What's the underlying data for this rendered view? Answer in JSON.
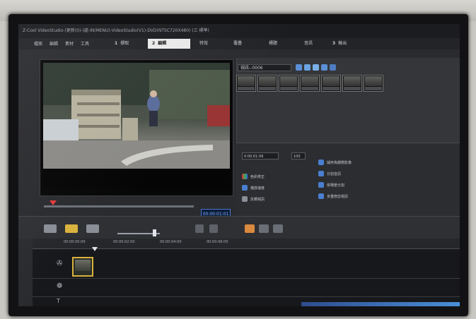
{
  "window": {
    "title": "Z-Cool VideoStudio-(更新(0)-)處-IN(MENU)-VideoStudio(V1)-DVD(NTSC720X480) (三 標準)"
  },
  "menu": {
    "items": [
      "檔案",
      "編輯",
      "素材",
      "工具"
    ]
  },
  "steps": [
    {
      "num": "1",
      "label": "擷取"
    },
    {
      "num": "2",
      "label": "編輯"
    },
    {
      "num": "",
      "label": "特效"
    },
    {
      "num": "",
      "label": "覆疊"
    },
    {
      "num": "",
      "label": "標題"
    },
    {
      "num": "",
      "label": "音訊"
    },
    {
      "num": "3",
      "label": "輸出"
    }
  ],
  "player": {
    "timecode": "00:00:01:01"
  },
  "library": {
    "dropdown": "視訊--0006",
    "thumb_count": 7
  },
  "options": {
    "duration_value": "0:00:01:09",
    "volume_value": "100",
    "items": [
      {
        "label": "色彩修正",
        "icon": "palette-icon"
      },
      {
        "label": "播放速度",
        "icon": "speed-icon"
      },
      {
        "label": "反轉視訊",
        "icon": "reverse-icon"
      },
      {
        "label": "儲存為靜態影像",
        "icon": "snapshot-icon"
      },
      {
        "label": "分割音訊",
        "icon": "split-audio-icon"
      },
      {
        "label": "依場景分割",
        "icon": "split-scene-icon"
      },
      {
        "label": "多重修剪視訊",
        "icon": "multi-trim-icon"
      }
    ]
  },
  "timeline": {
    "ruler": [
      "00:00:00:00",
      "00:00:02:00",
      "00:00:04:00",
      "00:00:06:00"
    ],
    "tracks": [
      "video-track-icon",
      "overlay-track-icon",
      "title-track-icon"
    ]
  },
  "colors": {
    "accent": "#d9b23e",
    "timecode": "#7fb0ff",
    "marker": "#e23a3a"
  }
}
